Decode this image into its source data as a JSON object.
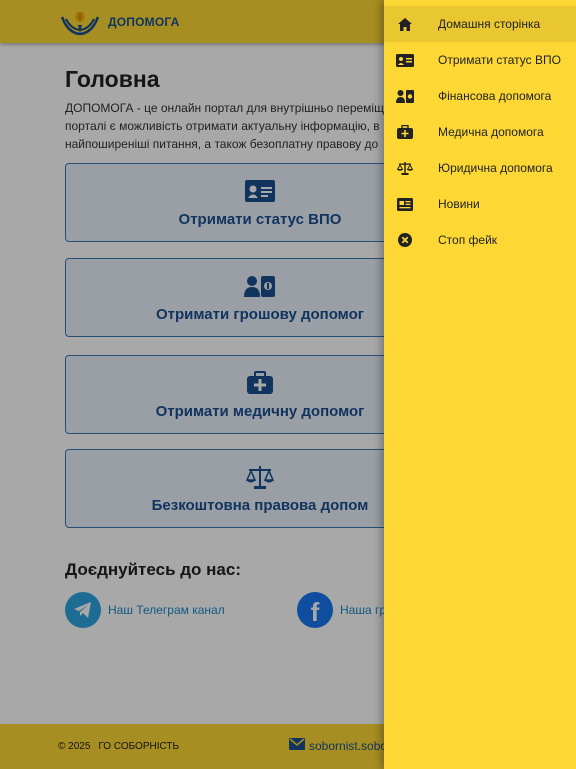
{
  "header": {
    "brand": "ДОПОМОГА"
  },
  "main": {
    "title": "Головна",
    "intro_lines": [
      "ДОПОМОГА - це онлайн портал для внутрішньо переміщ",
      "порталі є можливість отримати актуальну інформацію, в",
      "найпоширеніші питання, а також безоплатну правову до"
    ],
    "cards": [
      {
        "label": "Отримати статус ВПО",
        "icon": "id-card-icon"
      },
      {
        "label": "Отримати грошову допомог",
        "icon": "money-help-icon"
      },
      {
        "label": "Отримати медичну допомог",
        "icon": "medical-kit-icon"
      },
      {
        "label": "Безкоштовна правова допом",
        "icon": "scales-icon"
      }
    ],
    "join_title": "Доєднуйтесь до нас:",
    "social": [
      {
        "label": "Наш Телеграм канал",
        "icon": "telegram-icon",
        "color": "#2ca5e0"
      },
      {
        "label": "Наша гр",
        "icon": "facebook-icon",
        "color": "#1877f2"
      }
    ]
  },
  "footer": {
    "copyright": "© 2025",
    "org": "ГО СОБОРНІСТЬ",
    "email": "sobornist.sobo"
  },
  "drawer": {
    "items": [
      {
        "label": "Домашня сторінка",
        "icon": "home-icon",
        "active": true
      },
      {
        "label": "Отримати статус ВПО",
        "icon": "id-card-icon"
      },
      {
        "label": "Фінансова допомога",
        "icon": "money-help-icon"
      },
      {
        "label": "Медична допомога",
        "icon": "medical-kit-icon"
      },
      {
        "label": "Юридична допомога",
        "icon": "scales-icon"
      },
      {
        "label": "Новини",
        "icon": "news-icon"
      },
      {
        "label": "Стоп фейк",
        "icon": "cancel-icon"
      }
    ]
  },
  "colors": {
    "primary_yellow": "#fdd835",
    "accent_blue": "#1b4f8f",
    "card_bg": "#e9f1fb"
  }
}
